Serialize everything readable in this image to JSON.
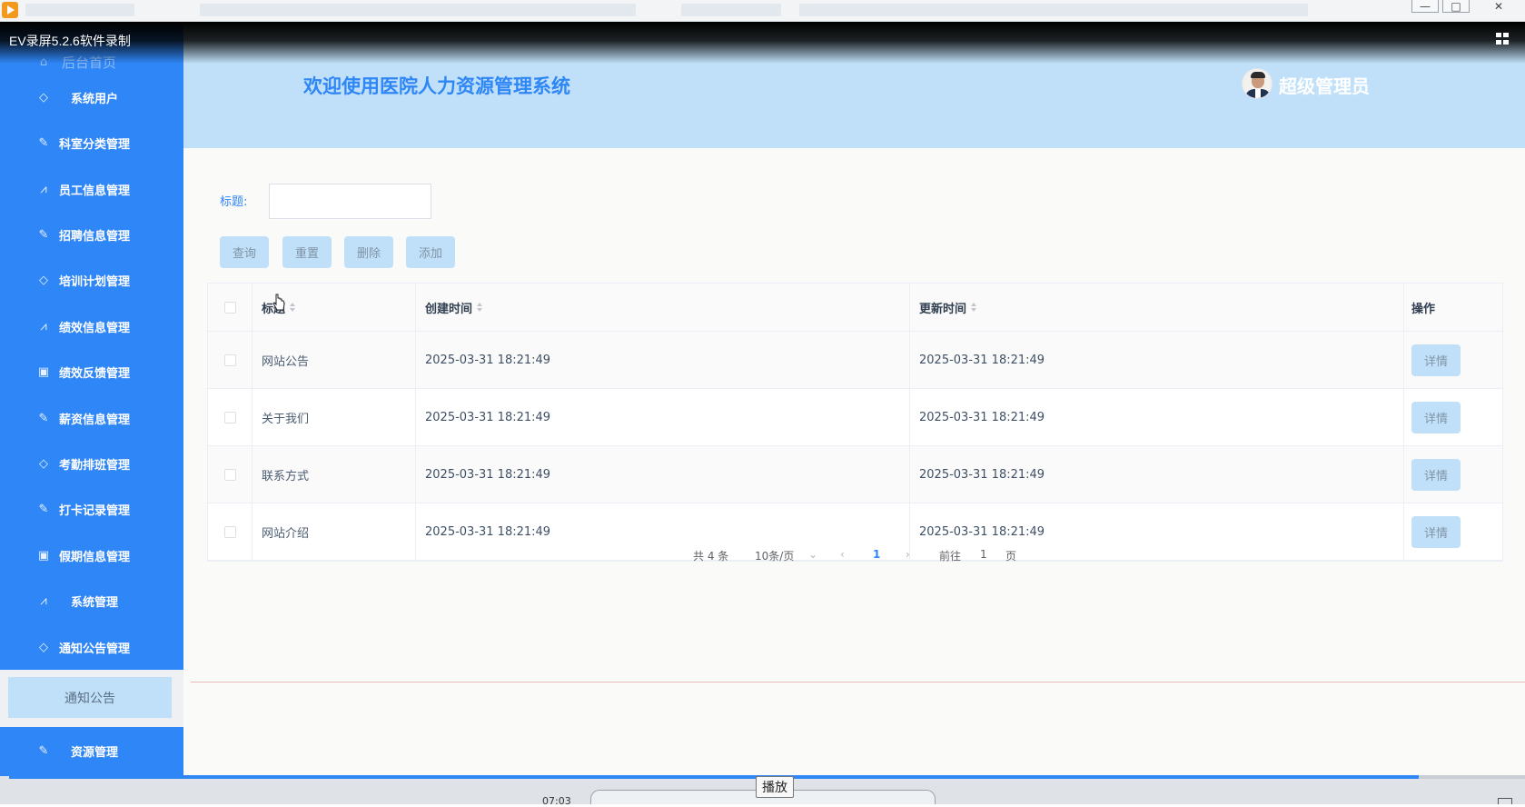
{
  "recording": {
    "label": "EV录屏5.2.6软件录制",
    "time": "07:03",
    "tooltip": "播放",
    "progress": 0.93
  },
  "sidebar": {
    "home_label": "后台首页",
    "items": [
      {
        "label": "系统用户",
        "icon": "diamond-icon"
      },
      {
        "label": "科室分类管理",
        "icon": "edit-icon"
      },
      {
        "label": "员工信息管理",
        "icon": "chart-icon"
      },
      {
        "label": "招聘信息管理",
        "icon": "edit-icon"
      },
      {
        "label": "培训计划管理",
        "icon": "diamond-icon"
      },
      {
        "label": "绩效信息管理",
        "icon": "chart-icon"
      },
      {
        "label": "绩效反馈管理",
        "icon": "bookmark-icon"
      },
      {
        "label": "薪资信息管理",
        "icon": "edit-icon"
      },
      {
        "label": "考勤排班管理",
        "icon": "diamond-icon"
      },
      {
        "label": "打卡记录管理",
        "icon": "edit-icon"
      },
      {
        "label": "假期信息管理",
        "icon": "bookmark-icon"
      },
      {
        "label": "系统管理",
        "icon": "chart-icon"
      },
      {
        "label": "通知公告管理",
        "icon": "diamond-icon"
      }
    ],
    "sub_item": "通知公告",
    "last_item": {
      "label": "资源管理",
      "icon": "edit-icon"
    }
  },
  "header": {
    "title": "欢迎使用医院人力资源管理系统",
    "user": "超级管理员"
  },
  "search": {
    "label": "标题:",
    "value": ""
  },
  "buttons": {
    "query": "查询",
    "reset": "重置",
    "delete": "删除",
    "add": "添加"
  },
  "table": {
    "columns": [
      "标题",
      "创建时间",
      "更新时间",
      "操作"
    ],
    "rows": [
      {
        "title": "网站公告",
        "created": "2025-03-31 18:21:49",
        "updated": "2025-03-31 18:21:49",
        "action": "详情"
      },
      {
        "title": "关于我们",
        "created": "2025-03-31 18:21:49",
        "updated": "2025-03-31 18:21:49",
        "action": "详情"
      },
      {
        "title": "联系方式",
        "created": "2025-03-31 18:21:49",
        "updated": "2025-03-31 18:21:49",
        "action": "详情"
      },
      {
        "title": "网站介绍",
        "created": "2025-03-31 18:21:49",
        "updated": "2025-03-31 18:21:49",
        "action": "详情"
      }
    ]
  },
  "pagination": {
    "total": "共 4 条",
    "page_size": "10条/页",
    "current": "1",
    "goto_prefix": "前往",
    "goto_value": "1",
    "goto_suffix": "页"
  },
  "colors": {
    "sidebar": "#2f86f6",
    "header": "#bfe0f8",
    "accent": "#2f86f6",
    "button": "#bfe0f8"
  }
}
